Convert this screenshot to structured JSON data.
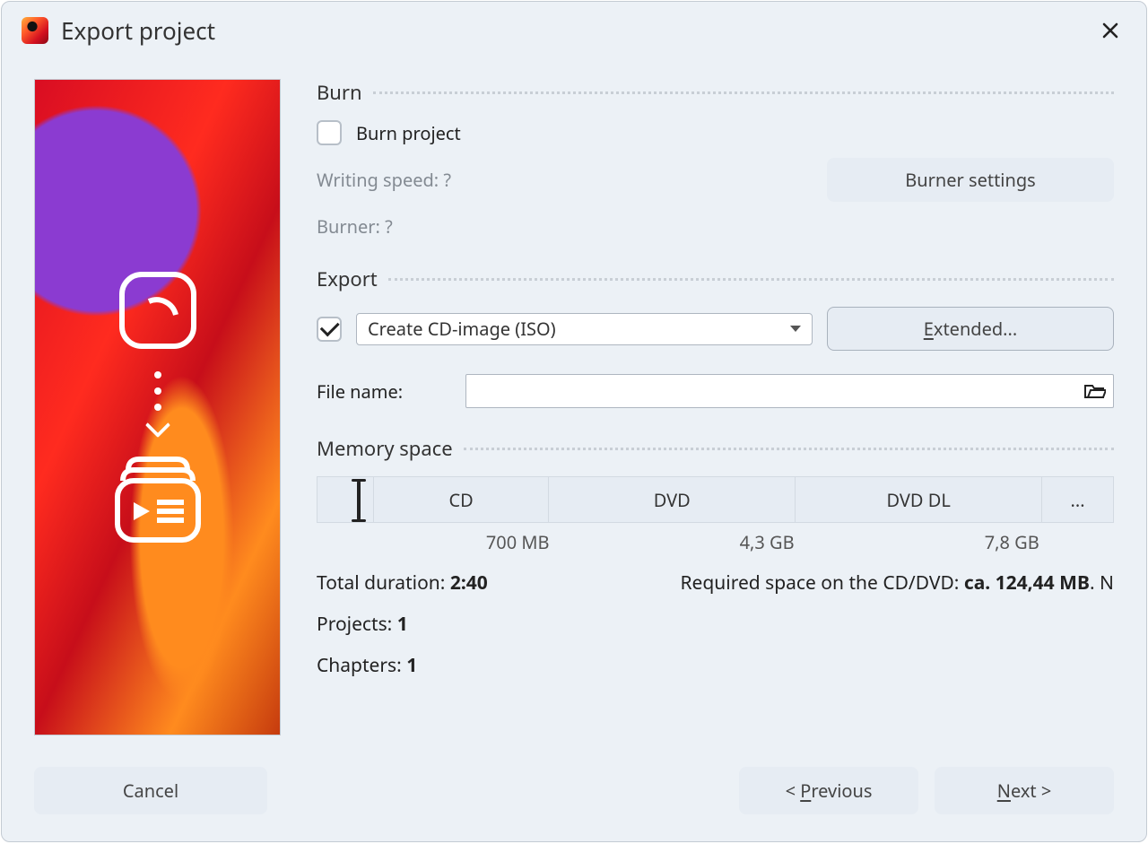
{
  "window": {
    "title": "Export project"
  },
  "burn": {
    "heading": "Burn",
    "checkbox_label": "Burn project",
    "checked": false,
    "writing_speed_label": "Writing speed: ?",
    "burner_label": "Burner: ?",
    "settings_btn": "Burner settings"
  },
  "export": {
    "heading": "Export",
    "checkbox_checked": true,
    "select_value": "Create CD-image (ISO)",
    "extended_btn_prefix": "E",
    "extended_btn_rest": "xtended...",
    "filename_label": "File name:",
    "filename_value": ""
  },
  "memory": {
    "heading": "Memory space",
    "segments": {
      "cd": "CD",
      "dvd": "DVD",
      "dvddl": "DVD DL",
      "more": "..."
    },
    "ticks": {
      "t1": "700 MB",
      "t2": "4,3 GB",
      "t3": "7,8 GB"
    }
  },
  "stats": {
    "total_duration_label": "Total duration: ",
    "total_duration_value": "2:40",
    "required_label": "Required space on the CD/DVD: ",
    "required_value": "ca. 124,44 MB",
    "required_tail": ". N",
    "projects_label": "Projects: ",
    "projects_value": "1",
    "chapters_label": "Chapters: ",
    "chapters_value": "1"
  },
  "buttons": {
    "cancel": "Cancel",
    "prev_prefix": "< ",
    "prev_ul": "P",
    "prev_rest": "revious",
    "next_ul": "N",
    "next_rest": "ext >"
  }
}
